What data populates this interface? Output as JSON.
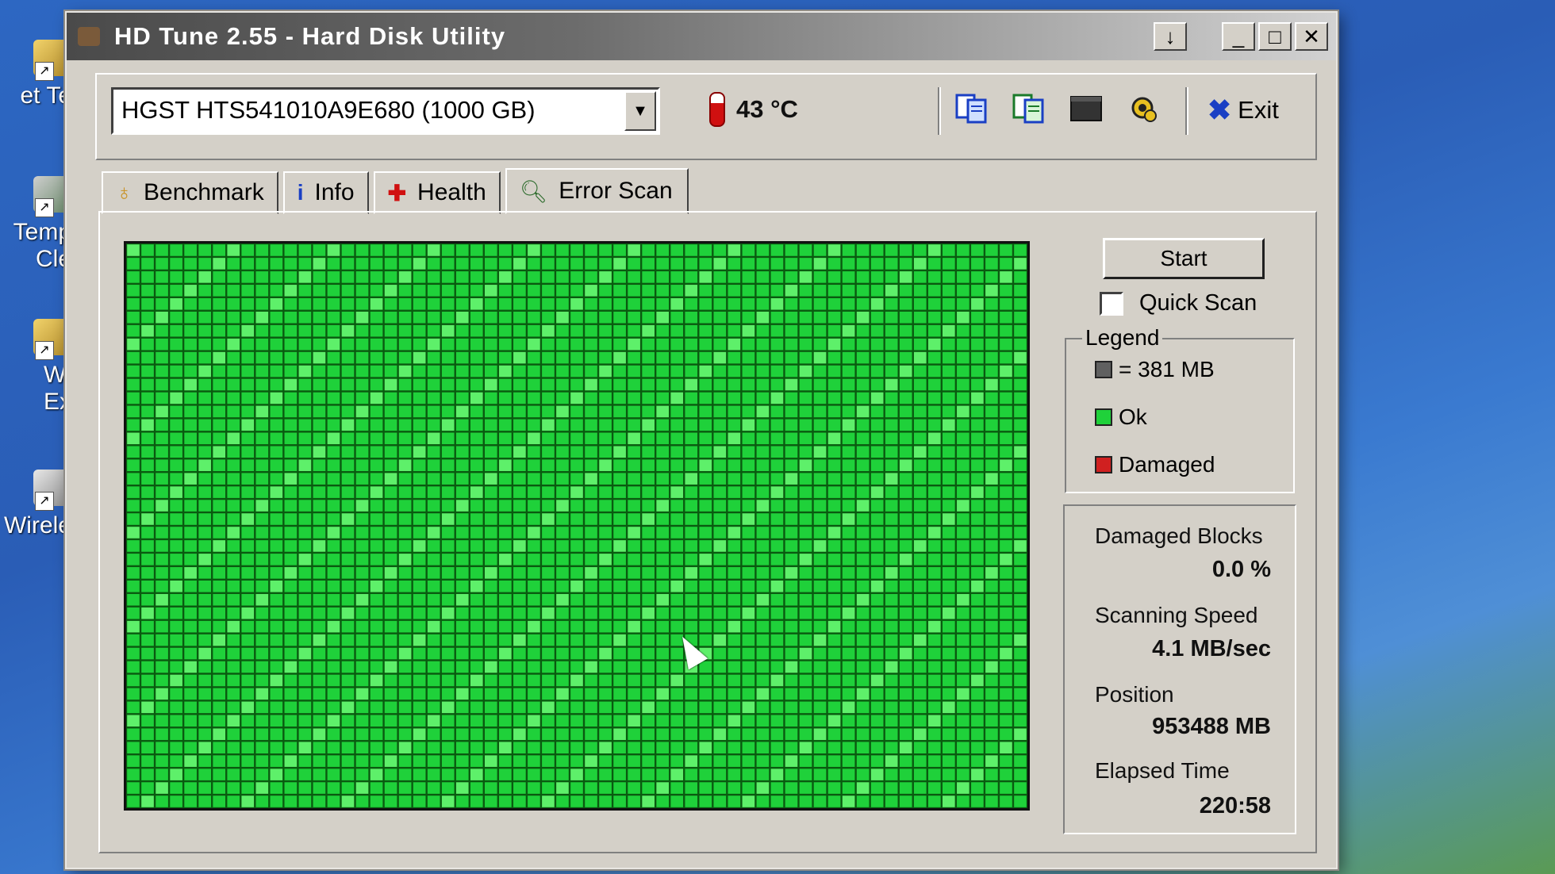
{
  "desktop": {
    "icons": [
      {
        "label_line1": "et Te",
        "label_line2": ""
      },
      {
        "label_line1": "Temp",
        "label_line2": "Cle"
      },
      {
        "label_line1": "Wi",
        "label_line2": "Ex"
      },
      {
        "label_line1": "Wirele",
        "label_line2": ""
      }
    ]
  },
  "window": {
    "title": "HD Tune 2.55 - Hard Disk Utility",
    "controls": {
      "download": "↓",
      "minimize": "_",
      "maximize": "□",
      "close": "✕"
    }
  },
  "toolbar": {
    "drive": "HGST HTS541010A9E680 (1000 GB)",
    "temperature": "43 °C",
    "icons": [
      "copy-info-icon",
      "copy-text-icon",
      "screenshot-icon",
      "options-icon"
    ],
    "exit_label": "Exit"
  },
  "tabs": [
    {
      "label": "Benchmark",
      "icon": "benchmark-icon",
      "active": false
    },
    {
      "label": "Info",
      "icon": "info-icon",
      "active": false
    },
    {
      "label": "Health",
      "icon": "health-icon",
      "active": false
    },
    {
      "label": "Error Scan",
      "icon": "magnifier-icon",
      "active": true
    }
  ],
  "error_scan": {
    "start_label": "Start",
    "quick_scan_label": "Quick Scan",
    "quick_scan_checked": false,
    "legend": {
      "title": "Legend",
      "block_size": "= 381 MB",
      "ok": "Ok",
      "damaged": "Damaged"
    },
    "colors": {
      "ok": "#1fd13a",
      "ok_light": "#5ef06a",
      "damaged": "#d02020",
      "block": "#606060",
      "grid_line": "#0a5a10"
    },
    "grid": {
      "columns": 63,
      "rows": 42,
      "all_ok": true
    },
    "stats": {
      "damaged_blocks_label": "Damaged Blocks",
      "damaged_blocks_value": "0.0 %",
      "scanning_speed_label": "Scanning Speed",
      "scanning_speed_value": "4.1 MB/sec",
      "position_label": "Position",
      "position_value": "953488 MB",
      "elapsed_label": "Elapsed Time",
      "elapsed_value": "220:58"
    }
  }
}
